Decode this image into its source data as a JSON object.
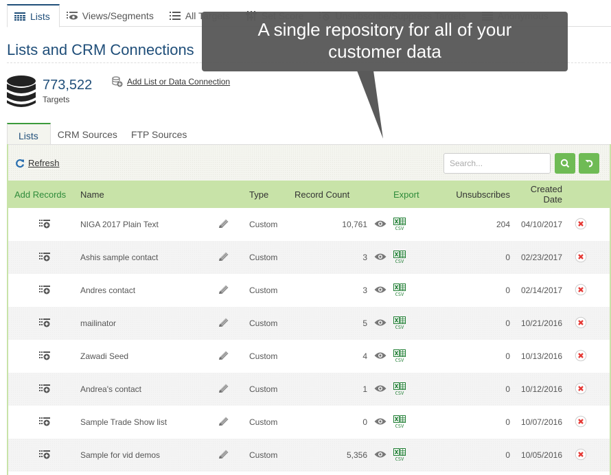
{
  "top_tabs": [
    {
      "label": "Lists",
      "icon": "table-icon",
      "active": true
    },
    {
      "label": "Views/Segments",
      "icon": "eye-list-icon",
      "active": false
    },
    {
      "label": "All Targets",
      "icon": "list-icon",
      "active": false
    },
    {
      "label": "Set Score",
      "icon": "sliders-icon",
      "active": false
    },
    {
      "label": "Unsubscribe/Suppress Targets",
      "icon": "unsubscribe-icon",
      "active": false
    },
    {
      "label": "Anonymous",
      "icon": "lines-icon",
      "active": false
    }
  ],
  "page": {
    "title": "Lists and CRM Connections",
    "targets_count": "773,522",
    "targets_label": "Targets",
    "add_connection_label": "Add List or Data Connection"
  },
  "sub_tabs": [
    {
      "label": "Lists",
      "active": true
    },
    {
      "label": "CRM Sources",
      "active": false
    },
    {
      "label": "FTP Sources",
      "active": false
    }
  ],
  "toolbar": {
    "refresh_label": "Refresh",
    "search_placeholder": "Search...",
    "search_value": ""
  },
  "table": {
    "columns": {
      "add_records": "Add Records",
      "name": "Name",
      "type": "Type",
      "record_count": "Record Count",
      "export": "Export",
      "unsubscribes": "Unsubscribes",
      "created_date": "Created Date"
    },
    "export_icon_text": "CSV",
    "rows": [
      {
        "name": "NIGA 2017 Plain Text",
        "type": "Custom",
        "record_count": "10,761",
        "unsubscribes": "204",
        "created_date": "04/10/2017"
      },
      {
        "name": "Ashis sample contact",
        "type": "Custom",
        "record_count": "3",
        "unsubscribes": "0",
        "created_date": "02/23/2017"
      },
      {
        "name": "Andres contact",
        "type": "Custom",
        "record_count": "3",
        "unsubscribes": "0",
        "created_date": "02/14/2017"
      },
      {
        "name": "mailinator",
        "type": "Custom",
        "record_count": "5",
        "unsubscribes": "0",
        "created_date": "10/21/2016"
      },
      {
        "name": "Zawadi Seed",
        "type": "Custom",
        "record_count": "4",
        "unsubscribes": "0",
        "created_date": "10/13/2016"
      },
      {
        "name": "Andrea's contact",
        "type": "Custom",
        "record_count": "1",
        "unsubscribes": "0",
        "created_date": "10/12/2016"
      },
      {
        "name": "Sample Trade Show list",
        "type": "Custom",
        "record_count": "0",
        "unsubscribes": "0",
        "created_date": "10/07/2016"
      },
      {
        "name": "Sample for vid demos",
        "type": "Custom",
        "record_count": "5,356",
        "unsubscribes": "0",
        "created_date": "10/05/2016"
      }
    ]
  },
  "callout": {
    "line1": "A single repository for all of your",
    "line2": "customer data"
  },
  "colors": {
    "brand_blue": "#1f4e79",
    "header_green": "#c8e3a8",
    "button_green": "#6fbb55",
    "delete_red": "#e53935",
    "excel_green": "#1e7d32",
    "callout_gray": "#5a5a5a"
  }
}
